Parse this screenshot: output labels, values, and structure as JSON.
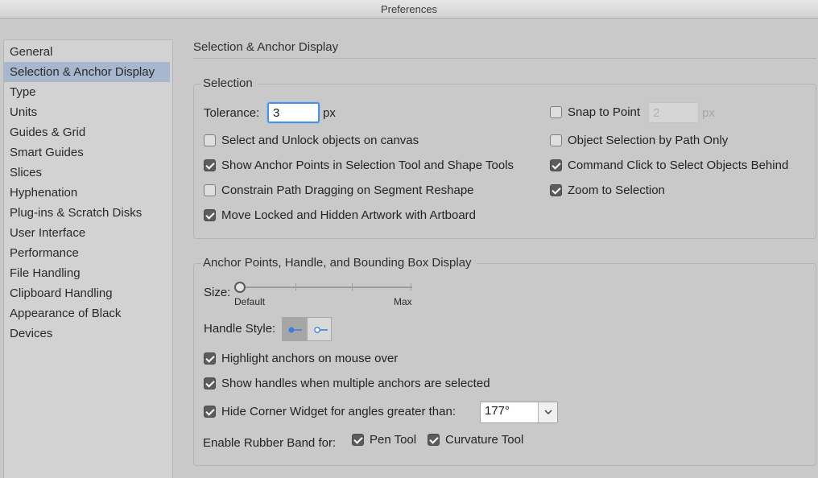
{
  "window": {
    "title": "Preferences"
  },
  "sidebar": {
    "items": [
      {
        "label": "General"
      },
      {
        "label": "Selection & Anchor Display",
        "selected": true
      },
      {
        "label": "Type"
      },
      {
        "label": "Units"
      },
      {
        "label": "Guides & Grid"
      },
      {
        "label": "Smart Guides"
      },
      {
        "label": "Slices"
      },
      {
        "label": "Hyphenation"
      },
      {
        "label": "Plug-ins & Scratch Disks"
      },
      {
        "label": "User Interface"
      },
      {
        "label": "Performance"
      },
      {
        "label": "File Handling"
      },
      {
        "label": "Clipboard Handling"
      },
      {
        "label": "Appearance of Black"
      },
      {
        "label": "Devices"
      }
    ]
  },
  "panel": {
    "title": "Selection & Anchor Display"
  },
  "selection": {
    "legend": "Selection",
    "tolerance_label": "Tolerance:",
    "tolerance_value": "3",
    "tolerance_unit": "px",
    "snap_to_point": {
      "label": "Snap to Point",
      "checked": false,
      "value": "2",
      "unit": "px"
    },
    "options": [
      {
        "label": "Select and Unlock objects on canvas",
        "checked": false
      },
      {
        "label": "Show Anchor Points in Selection Tool and Shape Tools",
        "checked": true
      },
      {
        "label": "Constrain Path Dragging on Segment Reshape",
        "checked": false
      },
      {
        "label": "Move Locked and Hidden Artwork with Artboard",
        "checked": true
      }
    ],
    "right_options": [
      {
        "label": "Object Selection by Path Only",
        "checked": false
      },
      {
        "label": "Command Click to Select Objects Behind",
        "checked": true
      },
      {
        "label": "Zoom to Selection",
        "checked": true
      }
    ]
  },
  "anchor": {
    "legend": "Anchor Points, Handle, and Bounding Box Display",
    "size_label": "Size:",
    "size_min_label": "Default",
    "size_max_label": "Max",
    "size_value": 0,
    "handle_style_label": "Handle Style:",
    "handle_style_selected": "solid",
    "options": [
      {
        "label": "Highlight anchors on mouse over",
        "checked": true
      },
      {
        "label": "Show handles when multiple anchors are selected",
        "checked": true
      }
    ],
    "corner_widget": {
      "label": "Hide Corner Widget for angles greater than:",
      "checked": true,
      "value": "177°"
    },
    "rubber_band_label": "Enable Rubber Band for:",
    "pen_tool": {
      "label": "Pen Tool",
      "checked": true
    },
    "curvature_tool": {
      "label": "Curvature Tool",
      "checked": true
    }
  },
  "colors": {
    "selection_highlight": "#a7b7cd",
    "focus_ring": "#4f8fe0",
    "handle_blue": "#3b7ddd"
  }
}
